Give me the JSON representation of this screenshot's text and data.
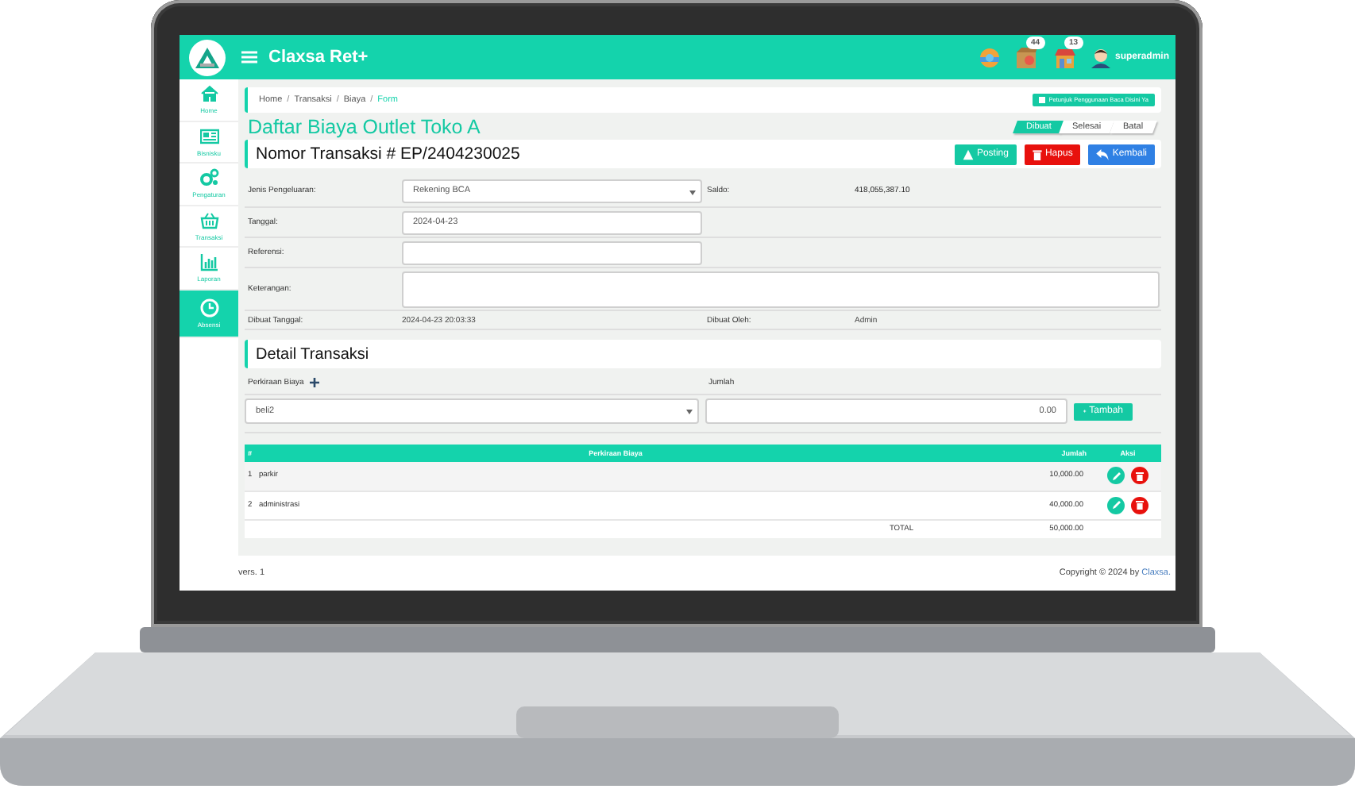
{
  "app": {
    "title": "Claxsa Ret+",
    "user": "superadmin",
    "notifications": [
      {
        "kind": "package",
        "badge": "44"
      },
      {
        "kind": "store",
        "badge": "13"
      }
    ]
  },
  "sidebar": {
    "items": [
      {
        "kind": "home",
        "label": "Home",
        "selected": false
      },
      {
        "kind": "news",
        "label": "Bisnisku",
        "selected": false
      },
      {
        "kind": "gears",
        "label": "Pengaturan",
        "selected": false
      },
      {
        "kind": "basket",
        "label": "Transaksi",
        "selected": false
      },
      {
        "kind": "chart",
        "label": "Laporan",
        "selected": false
      },
      {
        "kind": "clock",
        "label": "Absensi",
        "selected": true
      }
    ]
  },
  "breadcrumb_separator": "/",
  "breadcrumb": [
    {
      "label": "Home",
      "current": false
    },
    {
      "label": "Transaksi",
      "current": false
    },
    {
      "label": "Biaya",
      "current": false
    },
    {
      "label": "Form",
      "current": true
    }
  ],
  "guide_button": "Petunjuk Penggunaan Baca Disini Ya",
  "page_title": "Daftar Biaya Outlet Toko A",
  "status_steps": [
    {
      "label": "Dibuat",
      "selected": true
    },
    {
      "label": "Selesai",
      "selected": false
    },
    {
      "label": "Batal",
      "selected": false
    }
  ],
  "transaction_title": "Nomor Transaksi # EP/2404230025",
  "actions": [
    {
      "kind": "posting",
      "label": "Posting"
    },
    {
      "kind": "delete",
      "label": "Hapus"
    },
    {
      "kind": "back",
      "label": "Kembali"
    }
  ],
  "form": {
    "expense_type": {
      "label": "Jenis Pengeluaran:",
      "value": "Rekening BCA"
    },
    "balance": {
      "label": "Saldo:",
      "value": "418,055,387.10"
    },
    "date": {
      "label": "Tanggal:",
      "value": "2024-04-23"
    },
    "reference": {
      "label": "Referensi:"
    },
    "notes": {
      "label": "Keterangan:"
    },
    "created_at": {
      "label": "Dibuat Tanggal:",
      "value": "2024-04-23 20:03:33"
    },
    "created_by": {
      "label": "Dibuat Oleh:",
      "value": "Admin"
    }
  },
  "detail": {
    "title": "Detail Transaksi",
    "account_label": "Perkiraan Biaya",
    "account_value": "beli2",
    "amount_label": "Jumlah",
    "amount_value": "0.00",
    "add_button": "Tambah",
    "table": {
      "columns": [
        "#",
        "Perkiraan Biaya",
        "Jumlah",
        "Aksi"
      ],
      "rows": [
        {
          "no": "1",
          "account": "parkir",
          "amount": "10,000.00"
        },
        {
          "no": "2",
          "account": "administrasi",
          "amount": "40,000.00"
        }
      ],
      "total_label": "TOTAL",
      "total": "50,000.00"
    }
  },
  "footer": {
    "version": "vers. 1",
    "copyright": "Copyright © 2024 by",
    "brand": "Claxsa."
  }
}
